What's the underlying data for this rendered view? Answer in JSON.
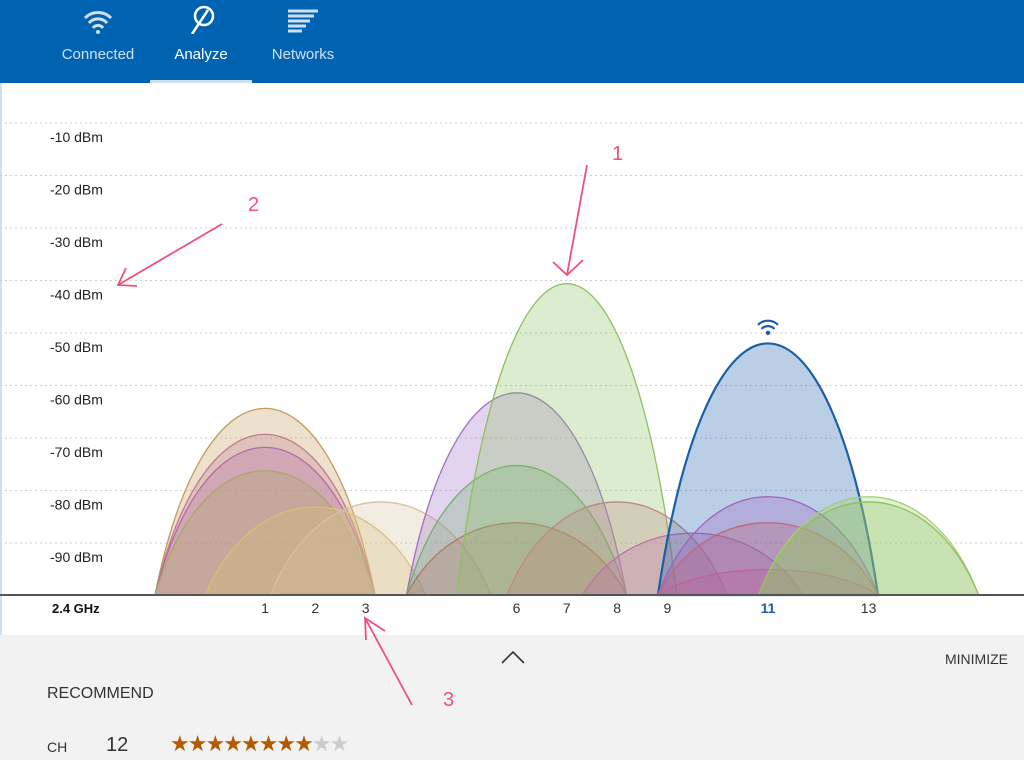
{
  "tabs": [
    {
      "label": "Connected",
      "icon": "wifi-icon"
    },
    {
      "label": "Analyze",
      "icon": "analyze-icon",
      "active": true
    },
    {
      "label": "Networks",
      "icon": "networks-list-icon"
    }
  ],
  "chart_data": {
    "type": "area",
    "band_label": "2.4 GHz",
    "ylim": [
      -100,
      -10
    ],
    "y_ticks": [
      "-10 dBm",
      "-20 dBm",
      "-30 dBm",
      "-40 dBm",
      "-50 dBm",
      "-60 dBm",
      "-70 dBm",
      "-80 dBm",
      "-90 dBm"
    ],
    "x_ticks": [
      "1",
      "2",
      "3",
      "6",
      "7",
      "8",
      "9",
      "11",
      "13"
    ],
    "x_tick_values": [
      1,
      2,
      3,
      6,
      7,
      8,
      9,
      11,
      13
    ],
    "highlight_channel": "11",
    "networks": [
      {
        "channel": 1,
        "dbm": -64,
        "color": "#c49a5c"
      },
      {
        "channel": 1,
        "dbm": -69,
        "color": "#c07a8c"
      },
      {
        "channel": 1,
        "dbm": -71.5,
        "color": "#b26aa8"
      },
      {
        "channel": 1,
        "dbm": -76,
        "color": "#a8a860"
      },
      {
        "channel": 2,
        "dbm": -83,
        "color": "#d8c070"
      },
      {
        "channel": 3.3,
        "dbm": -82,
        "color": "#d8c0a0"
      },
      {
        "channel": 6,
        "dbm": -61,
        "color": "#a070c8"
      },
      {
        "channel": 6,
        "dbm": -75,
        "color": "#70b070"
      },
      {
        "channel": 6,
        "dbm": -86,
        "color": "#b07868"
      },
      {
        "channel": 7,
        "dbm": -40,
        "color": "#8cc060"
      },
      {
        "channel": 8,
        "dbm": -82,
        "color": "#c08880"
      },
      {
        "channel": 9.5,
        "dbm": -88,
        "color": "#c070b0"
      },
      {
        "channel": 11,
        "dbm": -51.5,
        "color": "#1a5fa8",
        "connected": true
      },
      {
        "channel": 11,
        "dbm": -81,
        "color": "#a060c0"
      },
      {
        "channel": 11,
        "dbm": -86,
        "color": "#c06878"
      },
      {
        "channel": 11,
        "dbm": -95,
        "color": "#c060a0"
      },
      {
        "channel": 13,
        "dbm": -81,
        "color": "#a0d070"
      },
      {
        "channel": 13,
        "dbm": -82,
        "color": "#90c060"
      }
    ]
  },
  "panel": {
    "collapse_icon": "chevron-up-icon",
    "minimize": "MINIMIZE",
    "recommend": "RECOMMEND",
    "ch_label": "CH",
    "ch_value": "12",
    "rating": 8,
    "rating_max": 10
  },
  "annotations": [
    {
      "label": "1"
    },
    {
      "label": "2"
    },
    {
      "label": "3"
    }
  ],
  "colors": {
    "header": "#0063b1",
    "star": "#b35a00",
    "annotation": "#f0507a",
    "connected": "#1a5fa8"
  }
}
